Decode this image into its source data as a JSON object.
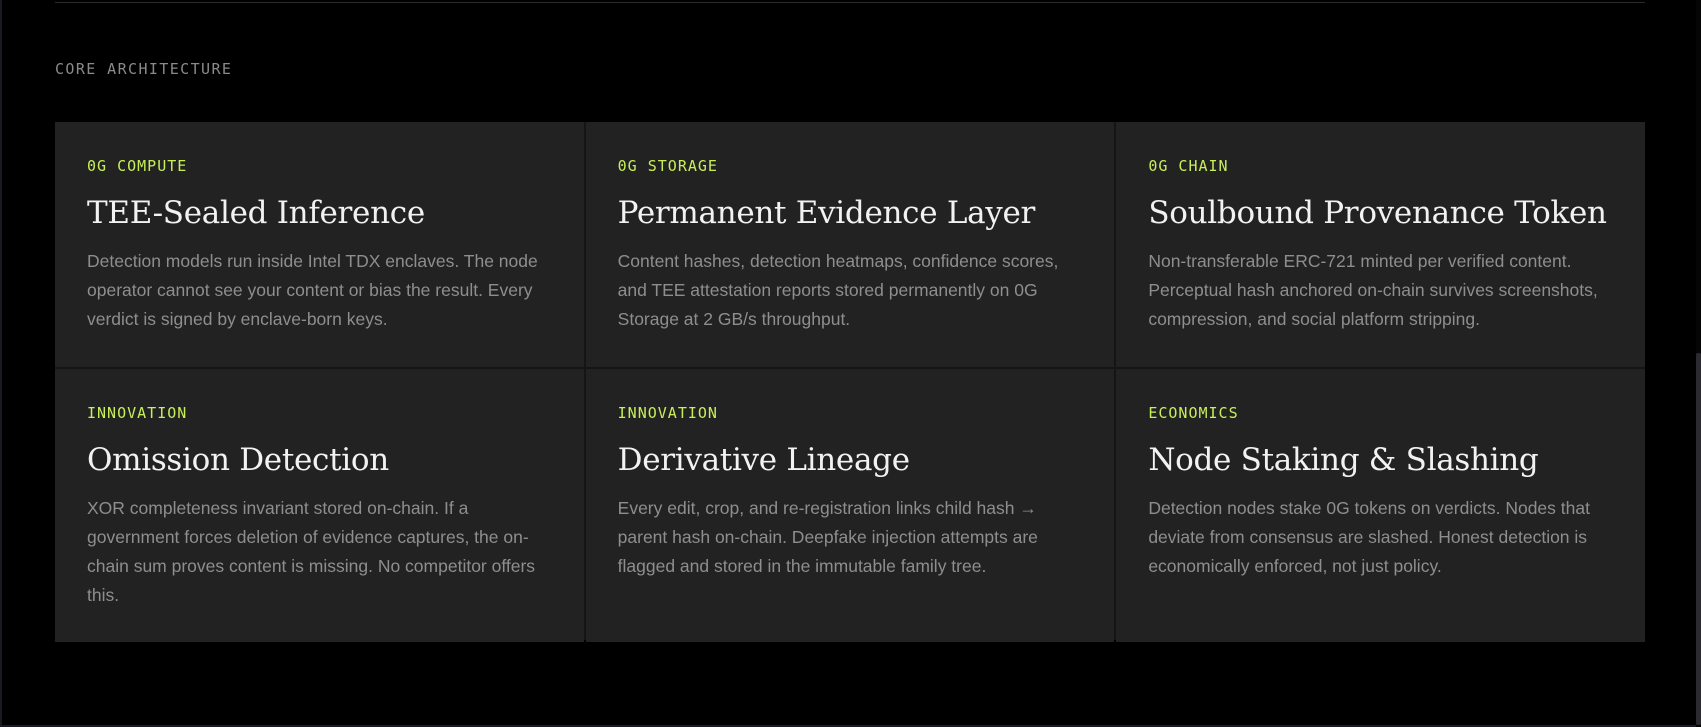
{
  "section": {
    "label": "CORE ARCHITECTURE"
  },
  "cards": [
    {
      "tag": "0G COMPUTE",
      "title": "TEE-Sealed Inference",
      "description": "Detection models run inside Intel TDX enclaves. The node operator cannot see your content or bias the result. Every verdict is signed by enclave-born keys."
    },
    {
      "tag": "0G STORAGE",
      "title": "Permanent Evidence Layer",
      "description": "Content hashes, detection heatmaps, confidence scores, and TEE attestation reports stored permanently on 0G Storage at 2 GB/s throughput."
    },
    {
      "tag": "0G CHAIN",
      "title": "Soulbound Provenance Token",
      "description": "Non-transferable ERC-721 minted per verified content. Perceptual hash anchored on-chain survives screenshots, compression, and social platform stripping."
    },
    {
      "tag": "INNOVATION",
      "title": "Omission Detection",
      "description": "XOR completeness invariant stored on-chain. If a government forces deletion of evidence captures, the on-chain sum proves content is missing. No competitor offers this."
    },
    {
      "tag": "INNOVATION",
      "title": "Derivative Lineage",
      "description": "Every edit, crop, and re-registration links child hash → parent hash on-chain. Deepfake injection attempts are flagged and stored in the immutable family tree."
    },
    {
      "tag": "ECONOMICS",
      "title": "Node Staking & Slashing",
      "description": "Detection nodes stake 0G tokens on verdicts. Nodes that deviate from consensus are slashed. Honest detection is economically enforced, not just policy."
    }
  ],
  "colors": {
    "accent": "#c7ef5a",
    "card_background": "#222222",
    "page_background": "#000000",
    "muted_text": "#8e8e8e"
  }
}
